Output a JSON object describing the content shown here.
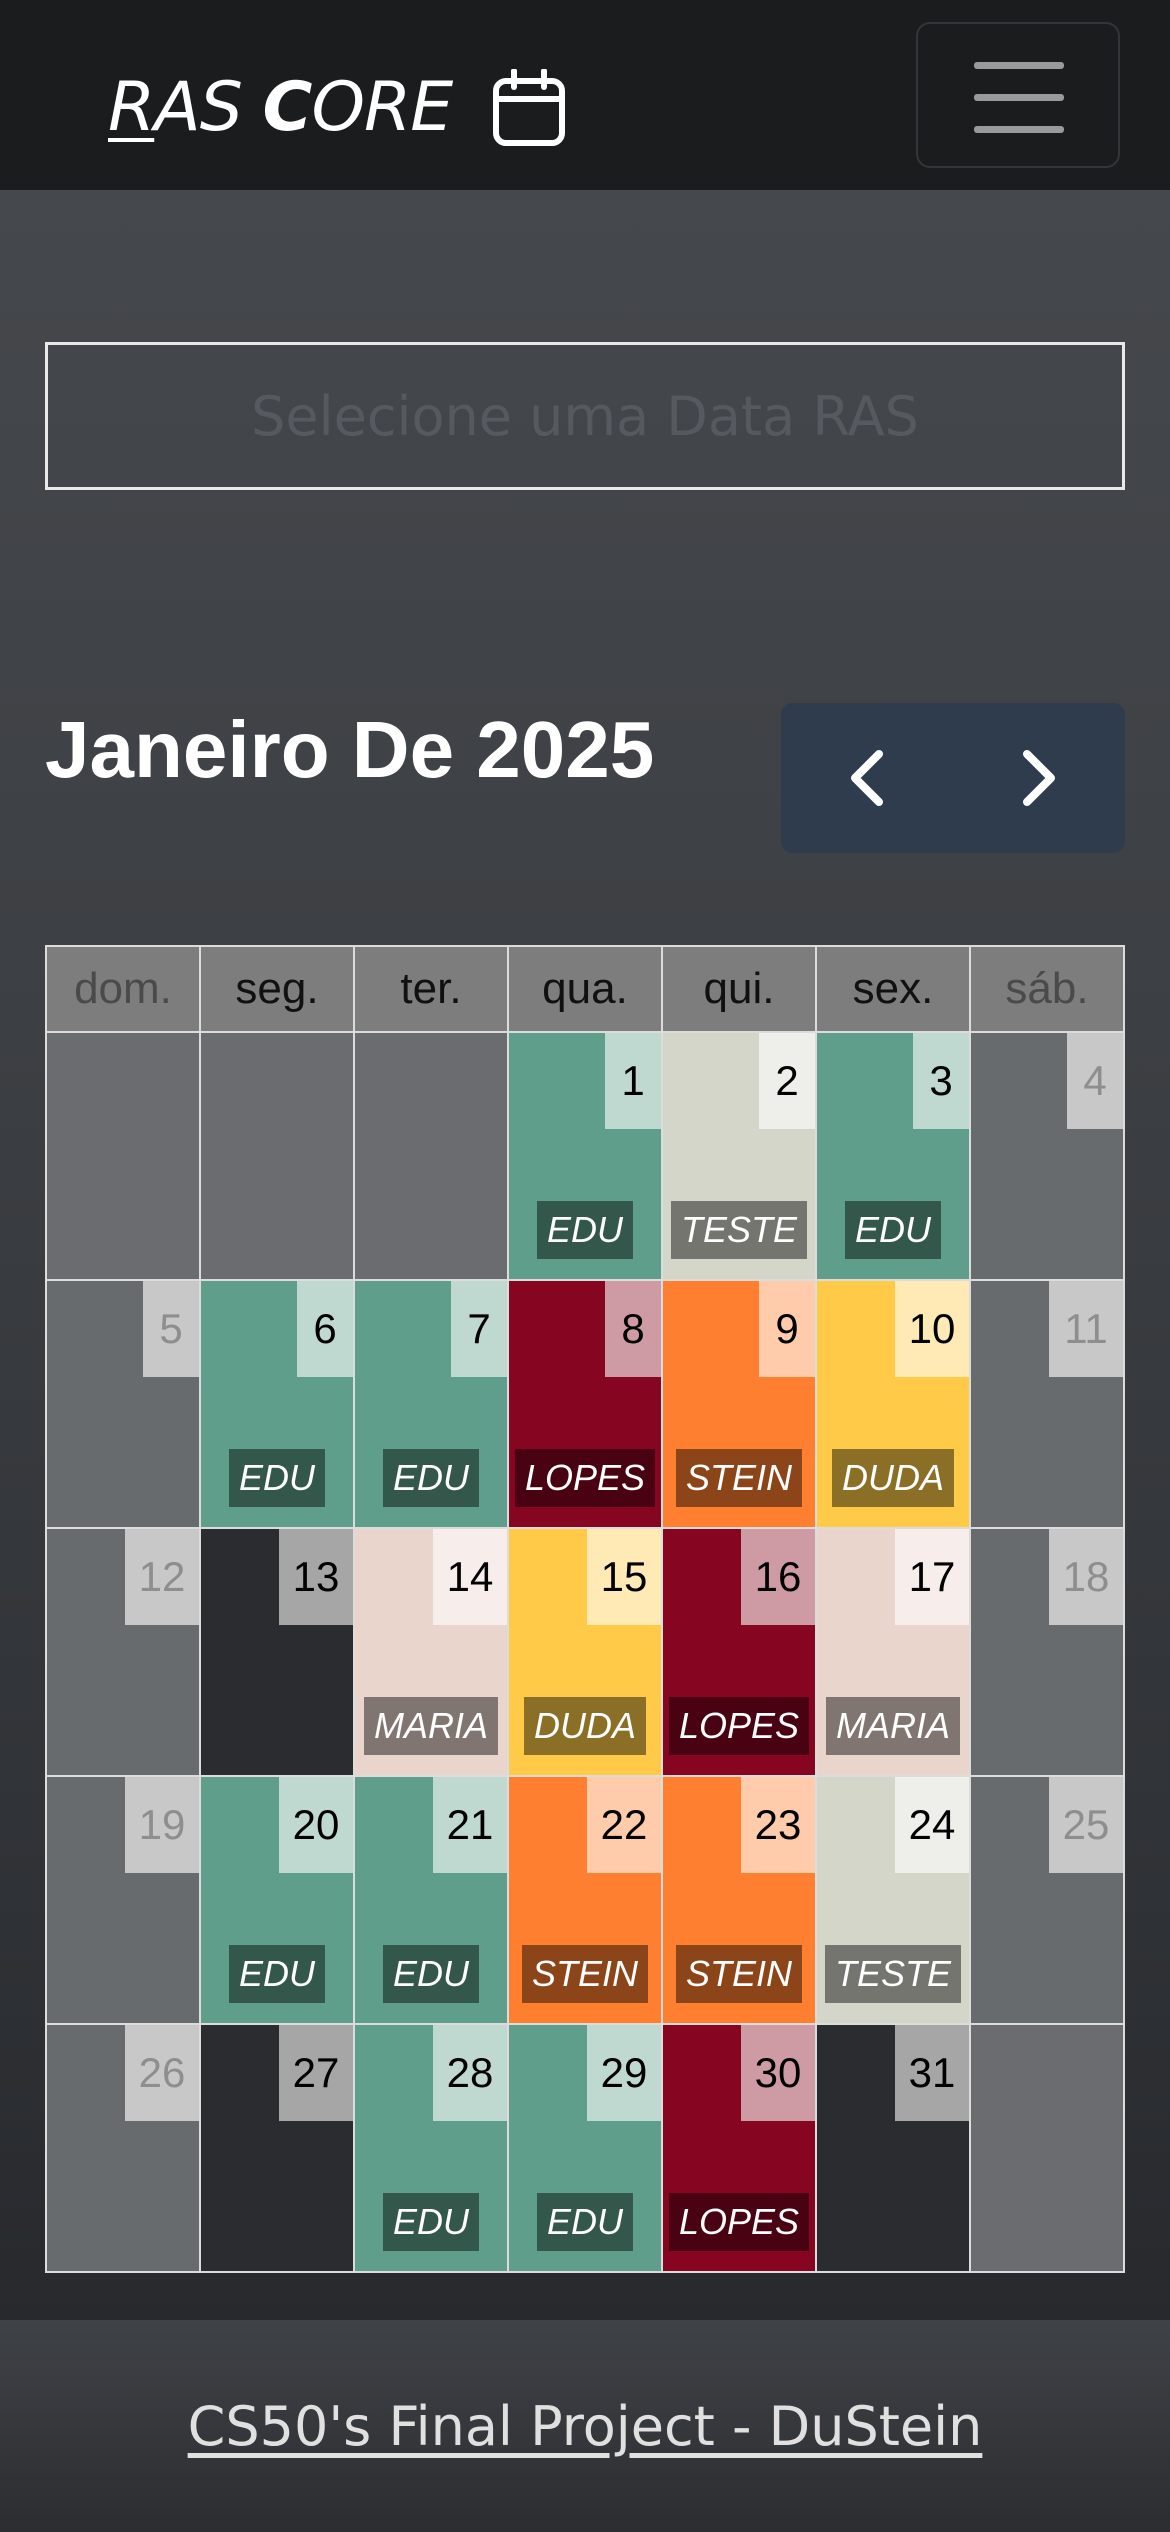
{
  "header": {
    "brand_part1": "R",
    "brand_part2": "AS ",
    "brand_part3": "C",
    "brand_part4": "ORE",
    "brand_icon": "calendar-icon",
    "menu_icon": "hamburger-menu-icon"
  },
  "date_selector": {
    "placeholder": "Selecione uma Data RAS"
  },
  "calendar": {
    "title": "Janeiro De 2025",
    "prev_icon": "chevron-left-icon",
    "next_icon": "chevron-right-icon",
    "weekdays": [
      "dom.",
      "seg.",
      "ter.",
      "qua.",
      "qui.",
      "sex.",
      "sáb."
    ],
    "weeks": [
      [
        {
          "day": "",
          "label": "",
          "color": ""
        },
        {
          "day": "",
          "label": "",
          "color": ""
        },
        {
          "day": "",
          "label": "",
          "color": ""
        },
        {
          "day": "1",
          "label": "EDU",
          "color": "#5f9e8a"
        },
        {
          "day": "2",
          "label": "TESTE",
          "color": "#d4d6ca"
        },
        {
          "day": "3",
          "label": "EDU",
          "color": "#5f9e8a"
        },
        {
          "day": "4",
          "label": "",
          "color": ""
        }
      ],
      [
        {
          "day": "5",
          "label": "",
          "color": ""
        },
        {
          "day": "6",
          "label": "EDU",
          "color": "#5f9e8a"
        },
        {
          "day": "7",
          "label": "EDU",
          "color": "#5f9e8a"
        },
        {
          "day": "8",
          "label": "LOPES",
          "color": "#860520"
        },
        {
          "day": "9",
          "label": "STEIN",
          "color": "#fd7f2f"
        },
        {
          "day": "10",
          "label": "DUDA",
          "color": "#feca47"
        },
        {
          "day": "11",
          "label": "",
          "color": ""
        }
      ],
      [
        {
          "day": "12",
          "label": "",
          "color": ""
        },
        {
          "day": "13",
          "label": "",
          "color": "busy"
        },
        {
          "day": "14",
          "label": "MARIA",
          "color": "#ead5cd"
        },
        {
          "day": "15",
          "label": "DUDA",
          "color": "#feca47"
        },
        {
          "day": "16",
          "label": "LOPES",
          "color": "#860520"
        },
        {
          "day": "17",
          "label": "MARIA",
          "color": "#ead5cd"
        },
        {
          "day": "18",
          "label": "",
          "color": ""
        }
      ],
      [
        {
          "day": "19",
          "label": "",
          "color": ""
        },
        {
          "day": "20",
          "label": "EDU",
          "color": "#5f9e8a"
        },
        {
          "day": "21",
          "label": "EDU",
          "color": "#5f9e8a"
        },
        {
          "day": "22",
          "label": "STEIN",
          "color": "#fd7f2f"
        },
        {
          "day": "23",
          "label": "STEIN",
          "color": "#fd7f2f"
        },
        {
          "day": "24",
          "label": "TESTE",
          "color": "#d4d6ca"
        },
        {
          "day": "25",
          "label": "",
          "color": ""
        }
      ],
      [
        {
          "day": "26",
          "label": "",
          "color": ""
        },
        {
          "day": "27",
          "label": "",
          "color": "busy"
        },
        {
          "day": "28",
          "label": "EDU",
          "color": "#5f9e8a"
        },
        {
          "day": "29",
          "label": "EDU",
          "color": "#5f9e8a"
        },
        {
          "day": "30",
          "label": "LOPES",
          "color": "#860520"
        },
        {
          "day": "31",
          "label": "",
          "color": "busy"
        },
        {
          "day": "",
          "label": "",
          "color": ""
        }
      ]
    ]
  },
  "footer": {
    "link_text": "CS50's Final Project - DuStein"
  }
}
